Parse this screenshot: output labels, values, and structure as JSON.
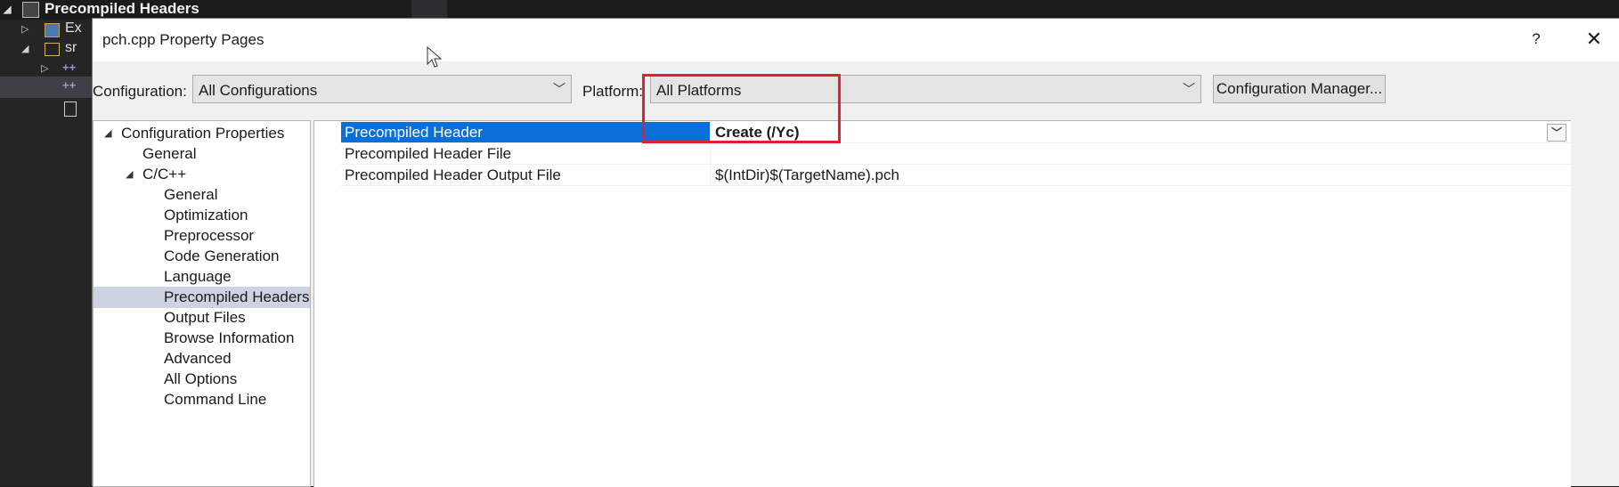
{
  "ide": {
    "solution_title": "Precompiled Headers",
    "tree_rows": [
      {
        "label": "Ex"
      },
      {
        "label": "sr"
      }
    ]
  },
  "dialog": {
    "title": "pch.cpp Property Pages",
    "help_label": "?",
    "close_label": "✕",
    "configuration_label": "Configuration:",
    "configuration_value": "All Configurations",
    "platform_label": "Platform:",
    "platform_value": "All Platforms",
    "config_manager_label": "Configuration Manager..."
  },
  "tree": {
    "nodes": [
      {
        "label": "Configuration Properties",
        "expander": "◢"
      },
      {
        "label": "General"
      },
      {
        "label": "C/C++",
        "expander": "◢"
      },
      {
        "label": "General"
      },
      {
        "label": "Optimization"
      },
      {
        "label": "Preprocessor"
      },
      {
        "label": "Code Generation"
      },
      {
        "label": "Language"
      },
      {
        "label": "Precompiled Headers",
        "selected": true
      },
      {
        "label": "Output Files"
      },
      {
        "label": "Browse Information"
      },
      {
        "label": "Advanced"
      },
      {
        "label": "All Options"
      },
      {
        "label": "Command Line"
      }
    ]
  },
  "properties": [
    {
      "name": "Precompiled Header",
      "value": "Create (/Yc)",
      "selected": true
    },
    {
      "name": "Precompiled Header File",
      "value": ""
    },
    {
      "name": "Precompiled Header Output File",
      "value": "$(IntDir)$(TargetName).pch"
    }
  ],
  "colors": {
    "selection_blue": "#0a6fd6",
    "highlight_red": "#e0202c",
    "tree_selected": "#cdd3e0"
  },
  "icons": [
    "triangle-expander-icon",
    "project-icon",
    "folder-icon",
    "cpp-file-icon",
    "header-file-icon",
    "dropdown-arrow-icon",
    "mouse-cursor-icon"
  ]
}
